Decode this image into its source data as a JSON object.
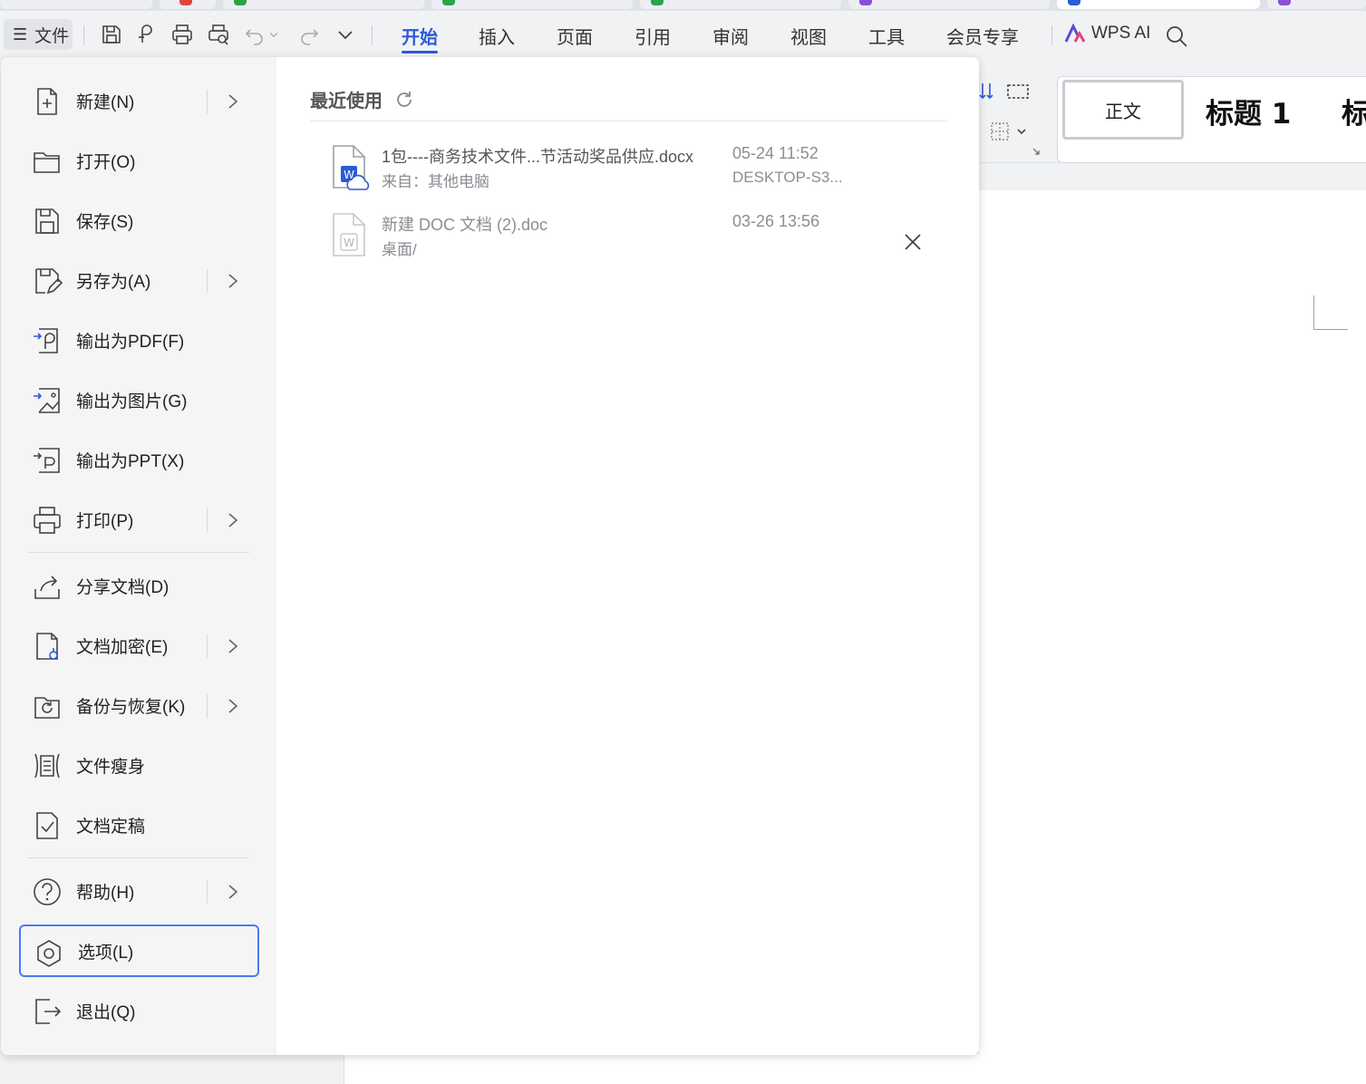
{
  "toolbar": {
    "file_menu_label": "文件",
    "tabs": [
      {
        "label": "开始",
        "active": true
      },
      {
        "label": "插入",
        "active": false
      },
      {
        "label": "页面",
        "active": false
      },
      {
        "label": "引用",
        "active": false
      },
      {
        "label": "审阅",
        "active": false
      },
      {
        "label": "视图",
        "active": false
      },
      {
        "label": "工具",
        "active": false
      },
      {
        "label": "会员专享",
        "active": false
      }
    ],
    "wps_ai_label": "WPS AI"
  },
  "ribbon": {
    "style_normal": "正文",
    "style_heading1": "标题 1",
    "style_heading2_partial": "标"
  },
  "file_menu": {
    "items": [
      {
        "label": "新建(N)",
        "icon": "new-document-icon",
        "has_submenu": true
      },
      {
        "label": "打开(O)",
        "icon": "folder-open-icon",
        "has_submenu": false
      },
      {
        "label": "保存(S)",
        "icon": "save-icon",
        "has_submenu": false
      },
      {
        "label": "另存为(A)",
        "icon": "save-as-icon",
        "has_submenu": true
      },
      {
        "label": "输出为PDF(F)",
        "icon": "export-pdf-icon",
        "has_submenu": false
      },
      {
        "label": "输出为图片(G)",
        "icon": "export-image-icon",
        "has_submenu": false
      },
      {
        "label": "输出为PPT(X)",
        "icon": "export-ppt-icon",
        "has_submenu": false
      },
      {
        "label": "打印(P)",
        "icon": "print-icon",
        "has_submenu": true
      },
      {
        "label": "分享文档(D)",
        "icon": "share-icon",
        "has_submenu": false
      },
      {
        "label": "文档加密(E)",
        "icon": "encrypt-icon",
        "has_submenu": true
      },
      {
        "label": "备份与恢复(K)",
        "icon": "backup-icon",
        "has_submenu": true
      },
      {
        "label": "文件瘦身",
        "icon": "slim-file-icon",
        "has_submenu": false
      },
      {
        "label": "文档定稿",
        "icon": "finalize-icon",
        "has_submenu": false
      },
      {
        "label": "帮助(H)",
        "icon": "help-icon",
        "has_submenu": true
      },
      {
        "label": "选项(L)",
        "icon": "options-gear-icon",
        "has_submenu": false,
        "selected": true
      },
      {
        "label": "退出(Q)",
        "icon": "exit-icon",
        "has_submenu": false
      }
    ]
  },
  "recent": {
    "title": "最近使用",
    "files": [
      {
        "name": "1包----商务技术文件...节活动奖品供应.docx",
        "source": "来自：其他电脑",
        "date": "05-24 11:52",
        "location": "DESKTOP-S3...",
        "icon": "cloud-word-doc-icon"
      },
      {
        "name": "新建 DOC 文档 (2).doc",
        "source": "桌面/",
        "date": "03-26 13:56",
        "location": "",
        "icon": "word-doc-icon"
      }
    ]
  },
  "colors": {
    "accent": "#2b5bd7",
    "selected_border": "#4a7cf0",
    "sidebar_bg": "#f5f5f6"
  }
}
